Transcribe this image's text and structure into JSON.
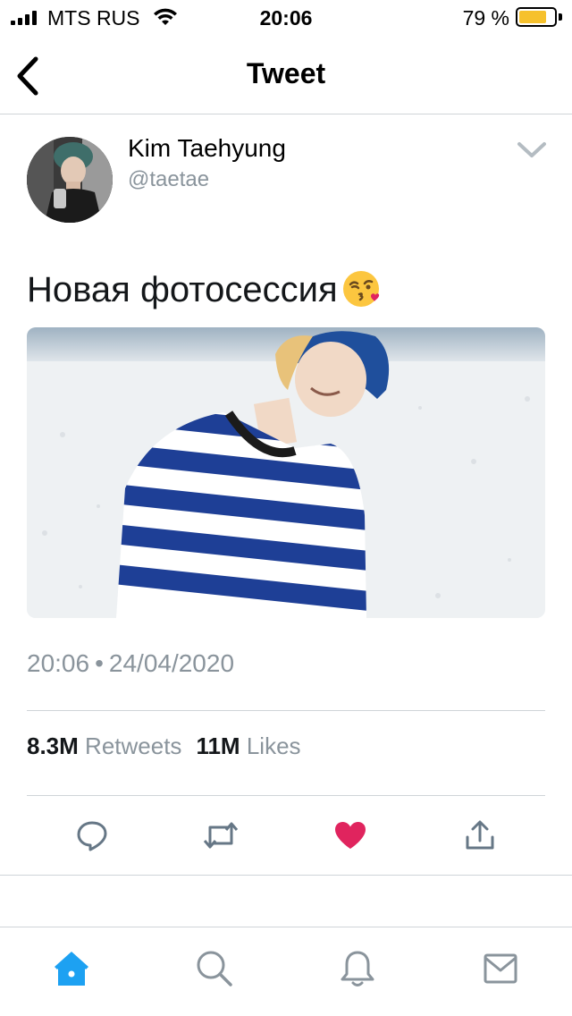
{
  "status_bar": {
    "carrier": "MTS RUS",
    "time": "20:06",
    "battery_percent": "79 %",
    "battery_level": 0.79,
    "battery_color": "#f6c12c"
  },
  "nav": {
    "title": "Tweet",
    "back_icon": "chevron-left-icon"
  },
  "tweet": {
    "author_name": "Kim Taehyung",
    "author_handle": "@taetae",
    "text": "Новая фотосессия",
    "emoji": "😘",
    "timestamp_time": "20:06",
    "timestamp_separator": "•",
    "timestamp_date": "24/04/2020",
    "retweets_count": "8.3M",
    "retweets_label": "Retweets",
    "likes_count": "11M",
    "likes_label": "Likes"
  },
  "actions": [
    {
      "icon": "reply-icon"
    },
    {
      "icon": "retweet-icon"
    },
    {
      "icon": "heart-icon",
      "active": true,
      "color": "#e0245e"
    },
    {
      "icon": "share-icon"
    }
  ],
  "tab_bar": [
    {
      "icon": "home-icon",
      "active": true,
      "color": "#1da1f2"
    },
    {
      "icon": "search-icon"
    },
    {
      "icon": "notifications-icon"
    },
    {
      "icon": "messages-icon"
    }
  ],
  "colors": {
    "accent": "#1da1f2",
    "like": "#e0245e",
    "secondary_text": "#8a949c"
  }
}
